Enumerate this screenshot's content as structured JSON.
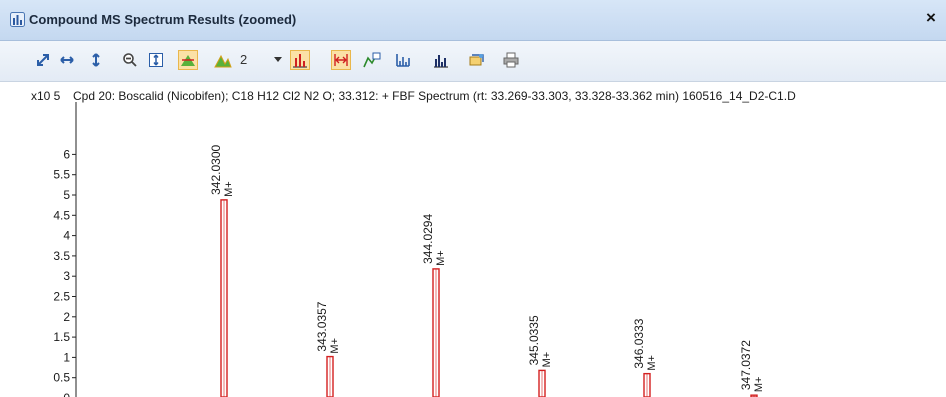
{
  "window": {
    "title": "Compound MS Spectrum Results (zoomed)",
    "close_label": "×"
  },
  "toolbar": {
    "icons": [
      "autoscale-xy-icon",
      "autoscale-x-icon",
      "autoscale-y-icon",
      "zoom-out-icon",
      "fit-y-icon",
      "peak-label-icon",
      "isotope-label-icon",
      "dropdown-arrow-icon",
      "bar-view-icon",
      "range-select-icon",
      "overlay-icon",
      "normalize-icon",
      "spectrum-icon",
      "copy-icon",
      "print-icon"
    ],
    "isotope_count": "2"
  },
  "plot": {
    "y_unit_label": "x10 5",
    "caption": "Cpd 20: Boscalid (Nicobifen); C18 H12 Cl2 N2 O; 33.312: + FBF Spectrum (rt: 33.269-33.303, 33.328-33.362 min) 160516_14_D2-C1.D"
  },
  "chart_data": {
    "type": "bar",
    "ylabel": "x10 5",
    "ylim": [
      0,
      6.5
    ],
    "y_ticks": [
      "0",
      "0.5",
      "1",
      "1.5",
      "2",
      "2.5",
      "3",
      "3.5",
      "4",
      "4.5",
      "5",
      "5.5",
      "6"
    ],
    "y_tick_values": [
      0,
      0.5,
      1,
      1.5,
      2,
      2.5,
      3,
      3.5,
      4,
      4.5,
      5,
      5.5,
      6
    ],
    "peaks": [
      {
        "mz": "342.0300",
        "value": 4.88,
        "annotation": "M+"
      },
      {
        "mz": "343.0357",
        "value": 1.02,
        "annotation": "M+"
      },
      {
        "mz": "344.0294",
        "value": 3.18,
        "annotation": "M+"
      },
      {
        "mz": "345.0335",
        "value": 0.68,
        "annotation": "M+"
      },
      {
        "mz": "346.0333",
        "value": 0.6,
        "annotation": "M+"
      },
      {
        "mz": "347.0372",
        "value": 0.07,
        "annotation": "M+"
      }
    ],
    "colors": {
      "bar_outline": "#d42020",
      "bar_fill": "#ffffff",
      "text": "#1a1a1a",
      "grid": "#f4f6f9"
    }
  }
}
